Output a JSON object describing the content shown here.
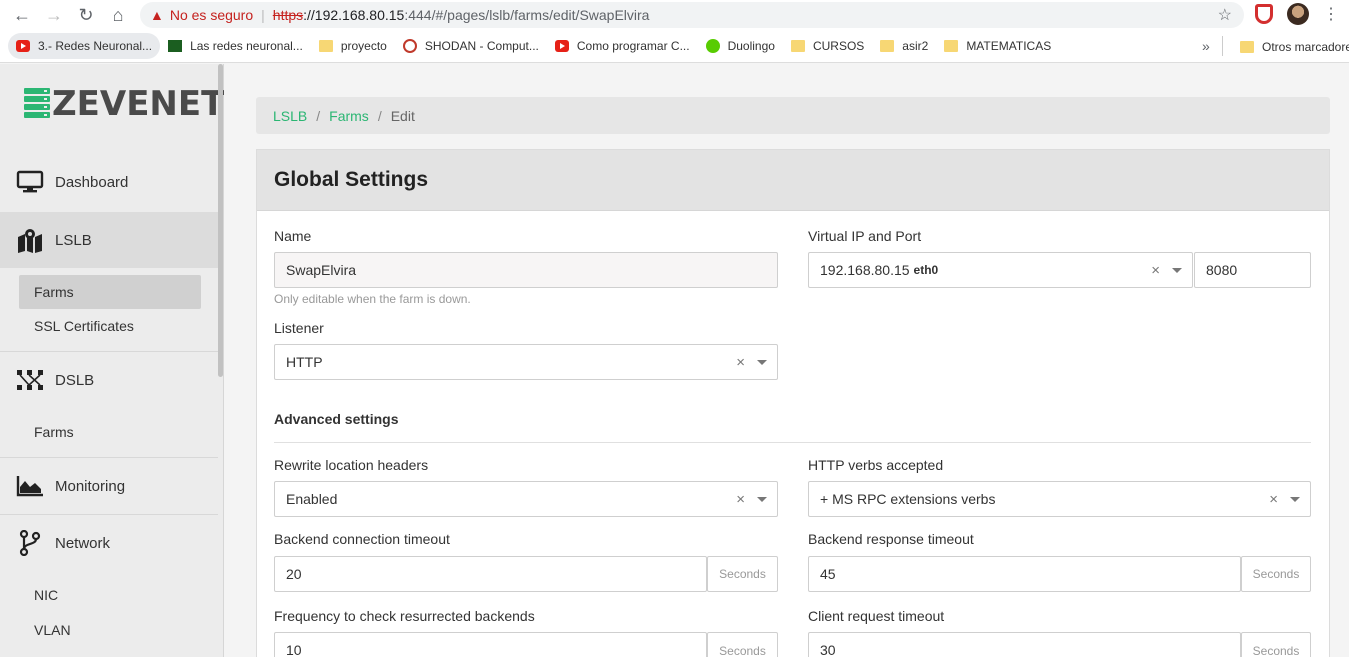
{
  "browser": {
    "not_secure": "No es seguro",
    "url_scheme": "https",
    "url_host": "://192.168.80.15",
    "url_rest": ":444/#/pages/lslb/farms/edit/SwapElvira",
    "more_bookmarks": "»",
    "bookmarks": [
      {
        "label": "3.- Redes Neuronal...",
        "icon": "youtube-icon"
      },
      {
        "label": "Las redes neuronal...",
        "icon": "site-icon"
      },
      {
        "label": "proyecto",
        "icon": "folder-icon"
      },
      {
        "label": "SHODAN - Comput...",
        "icon": "shodan-icon"
      },
      {
        "label": "Como programar C...",
        "icon": "youtube-icon"
      },
      {
        "label": "Duolingo",
        "icon": "duolingo-icon"
      },
      {
        "label": "CURSOS",
        "icon": "folder-icon"
      },
      {
        "label": "asir2",
        "icon": "folder-icon"
      },
      {
        "label": "MATEMATICAS",
        "icon": "folder-icon"
      }
    ],
    "other_bookmarks": "Otros marcadores"
  },
  "sidebar": {
    "logo_text": "ZEVENET",
    "brand_color": "#2bb673",
    "items": {
      "dashboard": "Dashboard",
      "lslb": "LSLB",
      "lslb_farms": "Farms",
      "ssl_certificates": "SSL Certificates",
      "dslb": "DSLB",
      "dslb_farms": "Farms",
      "monitoring": "Monitoring",
      "network": "Network",
      "nic": "NIC",
      "vlan": "VLAN"
    }
  },
  "breadcrumb": {
    "lslb": "LSLB",
    "sep1": "/",
    "farms": "Farms",
    "sep2": "/",
    "current": "Edit"
  },
  "form": {
    "title": "Global Settings",
    "name_label": "Name",
    "name_value": "SwapElvira",
    "name_help": "Only editable when the farm is down.",
    "vip_label": "Virtual IP and Port",
    "vip_value": "192.168.80.15",
    "vip_iface": "eth0",
    "port_value": "8080",
    "listener_label": "Listener",
    "listener_value": "HTTP",
    "advanced_title": "Advanced settings",
    "rewrite_label": "Rewrite location headers",
    "rewrite_value": "Enabled",
    "verbs_label": "HTTP verbs accepted",
    "verbs_value": "+ MS RPC extensions verbs",
    "backend_conn_label": "Backend connection timeout",
    "backend_conn_value": "20",
    "backend_resp_label": "Backend response timeout",
    "backend_resp_value": "45",
    "resurrect_label": "Frequency to check resurrected backends",
    "resurrect_value": "10",
    "client_req_label": "Client request timeout",
    "client_req_value": "30",
    "seconds_addon": "Seconds",
    "clear_symbol": "×"
  }
}
